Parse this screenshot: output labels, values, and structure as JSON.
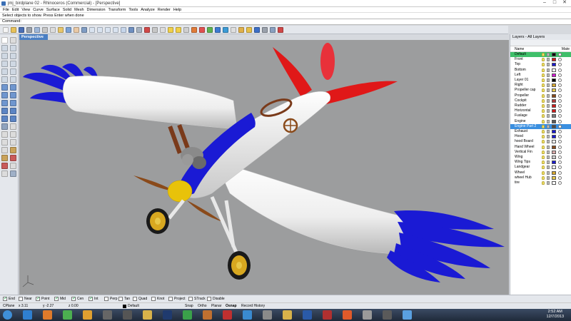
{
  "window": {
    "title": "jmj_birdplane 02 - Rhinoceros (Commercial) - [Perspective]",
    "controls": {
      "minimize": "–",
      "maximize": "□",
      "close": "✕"
    }
  },
  "menu": [
    "File",
    "Edit",
    "View",
    "Curve",
    "Surface",
    "Solid",
    "Mesh",
    "Dimension",
    "Transform",
    "Tools",
    "Analyze",
    "Render",
    "Help"
  ],
  "status_prompt": "Select objects to show. Press Enter when done",
  "command": {
    "label": "Command:",
    "value": ""
  },
  "viewport": {
    "label": "Perspective"
  },
  "toolbar_icons": [
    {
      "name": "new-file-icon",
      "color": "#f5f5f5"
    },
    {
      "name": "open-folder-icon",
      "color": "#e8c25a"
    },
    {
      "name": "save-icon",
      "color": "#4a6fb5"
    },
    {
      "name": "print-icon",
      "color": "#9aa1ab"
    },
    {
      "name": "import-icon",
      "color": "#9fb7d9"
    },
    {
      "name": "cut-icon",
      "color": "#c7c7c7"
    },
    {
      "name": "copy-icon",
      "color": "#dcdcdc"
    },
    {
      "name": "paste-icon",
      "color": "#e7c66a"
    },
    {
      "name": "undo-icon",
      "color": "#7aa2d6"
    },
    {
      "name": "pan-hand-icon",
      "color": "#e9c9a6"
    },
    {
      "name": "rotate-view-icon",
      "color": "#7f9cc3"
    },
    {
      "name": "zoom-icon",
      "color": "#d9e3f0"
    },
    {
      "name": "zoom-window-icon",
      "color": "#d9e3f0"
    },
    {
      "name": "zoom-extents-icon",
      "color": "#d9e3f0"
    },
    {
      "name": "zoom-selected-icon",
      "color": "#d9e3f0"
    },
    {
      "name": "undo-view-icon",
      "color": "#c6d5ea"
    },
    {
      "name": "four-viewports-icon",
      "color": "#6f8fc0"
    },
    {
      "name": "grid-icon",
      "color": "#a7b3c2"
    },
    {
      "name": "cplane-icon",
      "color": "#d04848"
    },
    {
      "name": "point-icon",
      "color": "#c7c7c7"
    },
    {
      "name": "select-icon",
      "color": "#dcdcdc"
    },
    {
      "name": "hide-icon",
      "color": "#f1d04a"
    },
    {
      "name": "show-icon",
      "color": "#f1d04a"
    },
    {
      "name": "lock-icon",
      "color": "#cfcfcf"
    },
    {
      "name": "layer-icon",
      "color": "#e07b39"
    },
    {
      "name": "properties-icon",
      "color": "#e05050"
    },
    {
      "name": "render-sphere-icon",
      "color": "#5fb24f"
    },
    {
      "name": "material-icon",
      "color": "#3d7ad1"
    },
    {
      "name": "environment-icon",
      "color": "#3b9bd6"
    },
    {
      "name": "render-preview-icon",
      "color": "#dedede"
    },
    {
      "name": "paint-palette-icon",
      "color": "#e0b04a"
    },
    {
      "name": "light-icon",
      "color": "#e6c04a"
    },
    {
      "name": "help-icon",
      "color": "#3d6fc7"
    },
    {
      "name": "tools-icon",
      "color": "#9aa1ab"
    },
    {
      "name": "options-icon",
      "color": "#8aa0c0"
    },
    {
      "name": "plugin-icon",
      "color": "#d04848"
    }
  ],
  "left_tools": [
    {
      "name": "select-tool-icon",
      "color": "#ffffff"
    },
    {
      "name": "point-tool-icon",
      "color": "#dcdcdc"
    },
    {
      "name": "polyline-tool-icon",
      "color": "#cfd8e3"
    },
    {
      "name": "curve-tool-icon",
      "color": "#cfd8e3"
    },
    {
      "name": "circle-tool-icon",
      "color": "#cfd8e3"
    },
    {
      "name": "arc-tool-icon",
      "color": "#cfd8e3"
    },
    {
      "name": "ellipse-tool-icon",
      "color": "#cfd8e3"
    },
    {
      "name": "rectangle-tool-icon",
      "color": "#cfd8e3"
    },
    {
      "name": "polygon-tool-icon",
      "color": "#cfd8e3"
    },
    {
      "name": "freeform-tool-icon",
      "color": "#cfd8e3"
    },
    {
      "name": "fillet-curve-tool-icon",
      "color": "#cfd8e3"
    },
    {
      "name": "offset-curve-tool-icon",
      "color": "#cfd8e3"
    },
    {
      "name": "surface-corner-tool-icon",
      "color": "#6f96cf"
    },
    {
      "name": "extrude-surface-tool-icon",
      "color": "#6f96cf"
    },
    {
      "name": "loft-tool-icon",
      "color": "#6f96cf"
    },
    {
      "name": "revolve-tool-icon",
      "color": "#6f96cf"
    },
    {
      "name": "sweep-tool-icon",
      "color": "#6f96cf"
    },
    {
      "name": "network-surface-tool-icon",
      "color": "#6f96cf"
    },
    {
      "name": "box-tool-icon",
      "color": "#5b84c4"
    },
    {
      "name": "sphere-tool-icon",
      "color": "#5b84c4"
    },
    {
      "name": "cylinder-tool-icon",
      "color": "#5b84c4"
    },
    {
      "name": "boolean-tool-icon",
      "color": "#5b84c4"
    },
    {
      "name": "mesh-tool-icon",
      "color": "#8fa3bf"
    },
    {
      "name": "move-tool-icon",
      "color": "#dcdcdc"
    },
    {
      "name": "copy-tool-icon",
      "color": "#dcdcdc"
    },
    {
      "name": "rotate-tool-icon",
      "color": "#dcdcdc"
    },
    {
      "name": "scale-tool-icon",
      "color": "#dcdcdc"
    },
    {
      "name": "mirror-tool-icon",
      "color": "#dcdcdc"
    },
    {
      "name": "array-tool-icon",
      "color": "#dcdcdc"
    },
    {
      "name": "join-tool-icon",
      "color": "#c9a25a"
    },
    {
      "name": "explode-tool-icon",
      "color": "#c9a25a"
    },
    {
      "name": "trim-tool-icon",
      "color": "#c95a5a"
    },
    {
      "name": "split-tool-icon",
      "color": "#c95a5a"
    },
    {
      "name": "dimension-tool-icon",
      "color": "#dcdcdc"
    },
    {
      "name": "text-tool-icon",
      "color": "#dcdcdc"
    },
    {
      "name": "analyze-tool-icon",
      "color": "#9fb0c8"
    }
  ],
  "layers_panel": {
    "title": "Layers - All Layers",
    "col_name": "Name",
    "col_material": "Mate",
    "layers": [
      {
        "name": "Default",
        "color": "#000000",
        "current": true
      },
      {
        "name": "Front",
        "color": "#d11a1a"
      },
      {
        "name": "Top",
        "color": "#1a1ad1"
      },
      {
        "name": "Bottom",
        "color": "#ffffff"
      },
      {
        "name": "Left",
        "color": "#d11ad1"
      },
      {
        "name": "Layer 01",
        "color": "#000000"
      },
      {
        "name": "Right",
        "color": "#d8a830"
      },
      {
        "name": "Propeller cap",
        "color": "#e6c84a"
      },
      {
        "name": "Propeller",
        "color": "#8a4a1a"
      },
      {
        "name": "Cockpit",
        "color": "#b03a3a"
      },
      {
        "name": "Rudder",
        "color": "#d11a1a"
      },
      {
        "name": "Horizontal",
        "color": "#d11a1a"
      },
      {
        "name": "Fuslage",
        "color": "#7a7a7a"
      },
      {
        "name": "Engine",
        "color": "#5a5a5a"
      },
      {
        "name": "Engine Part 2",
        "color": "#4a4a4a",
        "selected": true
      },
      {
        "name": "Exhaust",
        "color": "#1a1ad1"
      },
      {
        "name": "Hood",
        "color": "#1a1ad1"
      },
      {
        "name": "hood Board",
        "color": "#ffffff"
      },
      {
        "name": "Hand Wheel",
        "color": "#8a4a1a"
      },
      {
        "name": "Vertical Fin",
        "color": "#d8a8a8"
      },
      {
        "name": "Wing",
        "color": "#cccccc"
      },
      {
        "name": "Wing Tips",
        "color": "#1a1ad1"
      },
      {
        "name": "Landgear",
        "color": "#ffffff"
      },
      {
        "name": "Wheel",
        "color": "#d8a830"
      },
      {
        "name": "wheel Hub",
        "color": "#e6c84a"
      },
      {
        "name": "tire",
        "color": "#ffffff"
      }
    ]
  },
  "osnaps": [
    {
      "label": "End",
      "checked": true
    },
    {
      "label": "Near",
      "checked": false
    },
    {
      "label": "Point",
      "checked": true
    },
    {
      "label": "Mid",
      "checked": true
    },
    {
      "label": "Cen",
      "checked": true
    },
    {
      "label": "Int",
      "checked": true
    },
    {
      "label": "Perp",
      "checked": false
    },
    {
      "label": "Tan",
      "checked": false
    },
    {
      "label": "Quad",
      "checked": false
    },
    {
      "label": "Knot",
      "checked": false
    },
    {
      "label": "Project",
      "checked": false
    },
    {
      "label": "STrack",
      "checked": false
    },
    {
      "label": "Disable",
      "checked": false
    }
  ],
  "status": {
    "cplane": "CPlane",
    "x": "x 3.11",
    "y": "y -2.27",
    "z": "z 0.00",
    "layer": "Default",
    "snap": "Snap",
    "ortho": "Ortho",
    "planar": "Planar",
    "osnap": "Osnap",
    "record_history": "Record History"
  },
  "taskbar": {
    "time": "2:52 AM",
    "date": "12/7/2013",
    "apps": [
      {
        "name": "start-button-icon",
        "color": "#3f8fd8"
      },
      {
        "name": "ie-browser-icon",
        "color": "#2f7fd0"
      },
      {
        "name": "firefox-icon",
        "color": "#e07a2a"
      },
      {
        "name": "chrome-icon",
        "color": "#4caf50"
      },
      {
        "name": "media-player-icon",
        "color": "#e0a030"
      },
      {
        "name": "unity-icon",
        "color": "#666666"
      },
      {
        "name": "rhino-app-icon",
        "color": "#555555"
      },
      {
        "name": "explorer-icon",
        "color": "#d8b24a"
      },
      {
        "name": "photoshop-icon",
        "color": "#1f3a6e"
      },
      {
        "name": "msn-icon",
        "color": "#3aa04a"
      },
      {
        "name": "illustrator-icon",
        "color": "#c07030"
      },
      {
        "name": "pdf-icon",
        "color": "#c03030"
      },
      {
        "name": "paint-icon",
        "color": "#3a8ad0"
      },
      {
        "name": "network-icon",
        "color": "#8a8a8a"
      },
      {
        "name": "folder-icon",
        "color": "#d8b24a"
      },
      {
        "name": "word-icon",
        "color": "#2a5aa8"
      },
      {
        "name": "acrobat-icon",
        "color": "#b03030"
      },
      {
        "name": "firefox2-icon",
        "color": "#e05a2a"
      },
      {
        "name": "video-icon",
        "color": "#9a9a9a"
      },
      {
        "name": "util-icon",
        "color": "#5a5a5a"
      },
      {
        "name": "paint2-icon",
        "color": "#5aa0e0"
      }
    ]
  }
}
